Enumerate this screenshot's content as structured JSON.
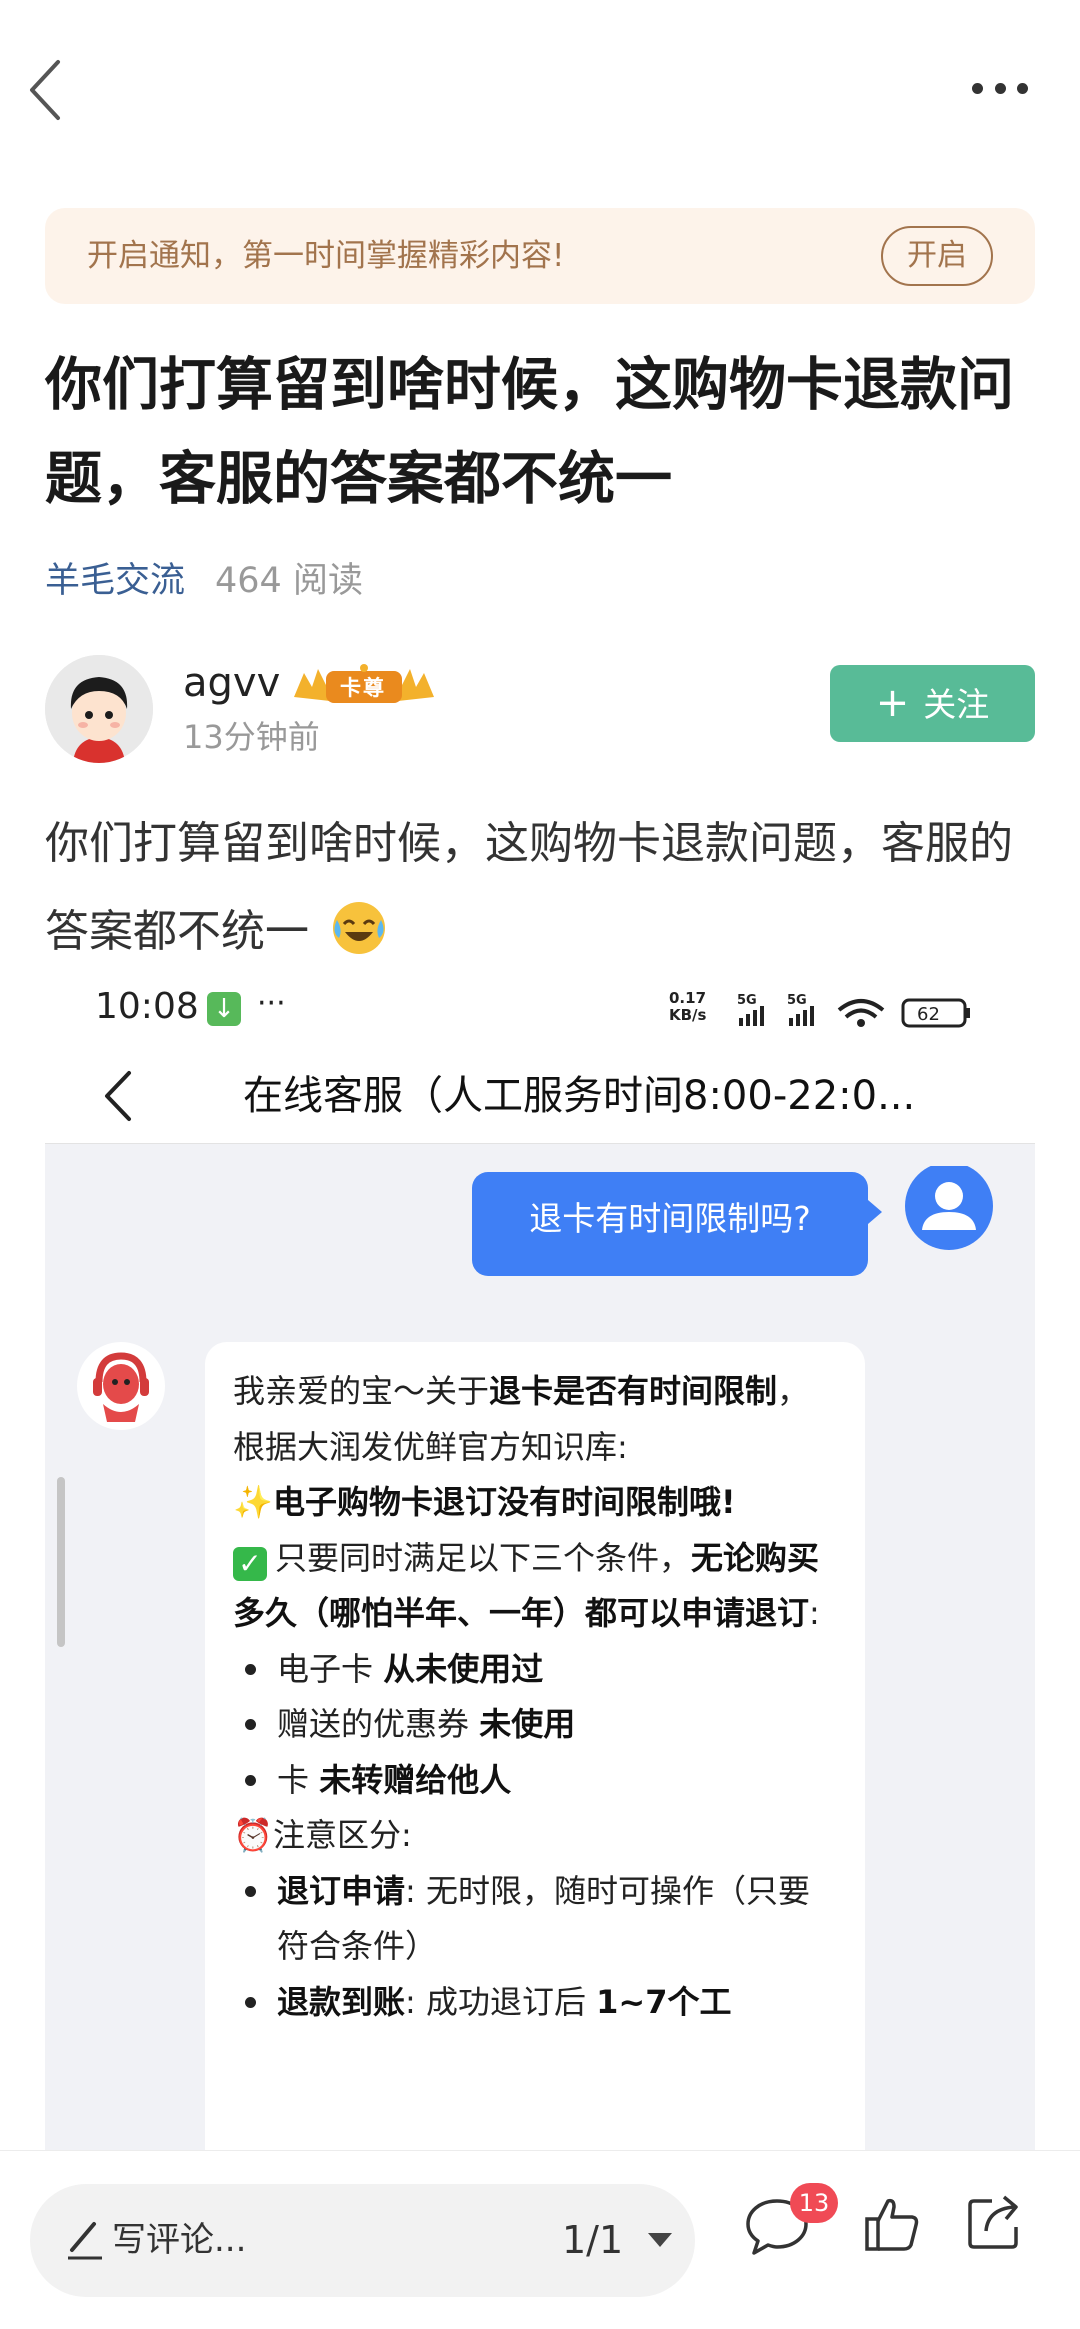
{
  "notification": {
    "text": "开启通知，第一时间掌握精彩内容!",
    "button": "开启"
  },
  "post": {
    "title": "你们打算留到啥时候，这购物卡退款问题，客服的答案都不统一",
    "category": "羊毛交流",
    "reads": "464 阅读",
    "body": "你们打算留到啥时候，这购物卡退款问题，客服的答案都不统一",
    "body_emoji": "crying-laughing-emoji"
  },
  "author": {
    "name": "agvv",
    "badge": "卡尊",
    "time": "13分钟前",
    "follow_label": "关注"
  },
  "screenshot": {
    "status": {
      "time": "10:08",
      "dots": "···",
      "net_speed_value": "0.17",
      "net_speed_unit": "KB/s",
      "battery": "62"
    },
    "nav_title": "在线客服（人工服务时间8:00-22:0...",
    "user_message": "退卡有时间限制吗?",
    "bot": {
      "greeting": "我亲爱的宝～关于",
      "greeting_bold": "退卡是否有时间限制",
      "greeting_tail": "，根据大润发优鲜官方知识库:",
      "sparkle": "✨",
      "headline": "电子购物卡退订没有时间限制哦!",
      "cond_intro": "只要同时满足以下三个条件，",
      "cond_intro_bold": "无论购买多久（哪怕半年、一年）都可以申请退订",
      "cond_intro_tail": ":",
      "conditions": [
        {
          "prefix": "电子卡 ",
          "bold": "从未使用过"
        },
        {
          "prefix": "赠送的优惠券 ",
          "bold": "未使用"
        },
        {
          "prefix": "卡 ",
          "bold": "未转赠给他人"
        }
      ],
      "alarm": "⏰",
      "note_title": "注意区分:",
      "notes": [
        {
          "bold": "退订申请",
          "text": ": 无时限，随时可操作（只要符合条件）"
        },
        {
          "bold": "退款到账",
          "text": ": 成功退订后 ",
          "bold2": "1~7个工"
        }
      ]
    }
  },
  "bottom": {
    "comment_placeholder": "写评论...",
    "pager": "1/1",
    "comment_count": "13"
  },
  "colors": {
    "accent_green": "#58bb97",
    "notify_bg": "#fdf3ea",
    "notify_text": "#a2744d",
    "category_blue": "#3a5f93",
    "chat_blue": "#3f7ff5",
    "badge_red": "#f04a55"
  }
}
